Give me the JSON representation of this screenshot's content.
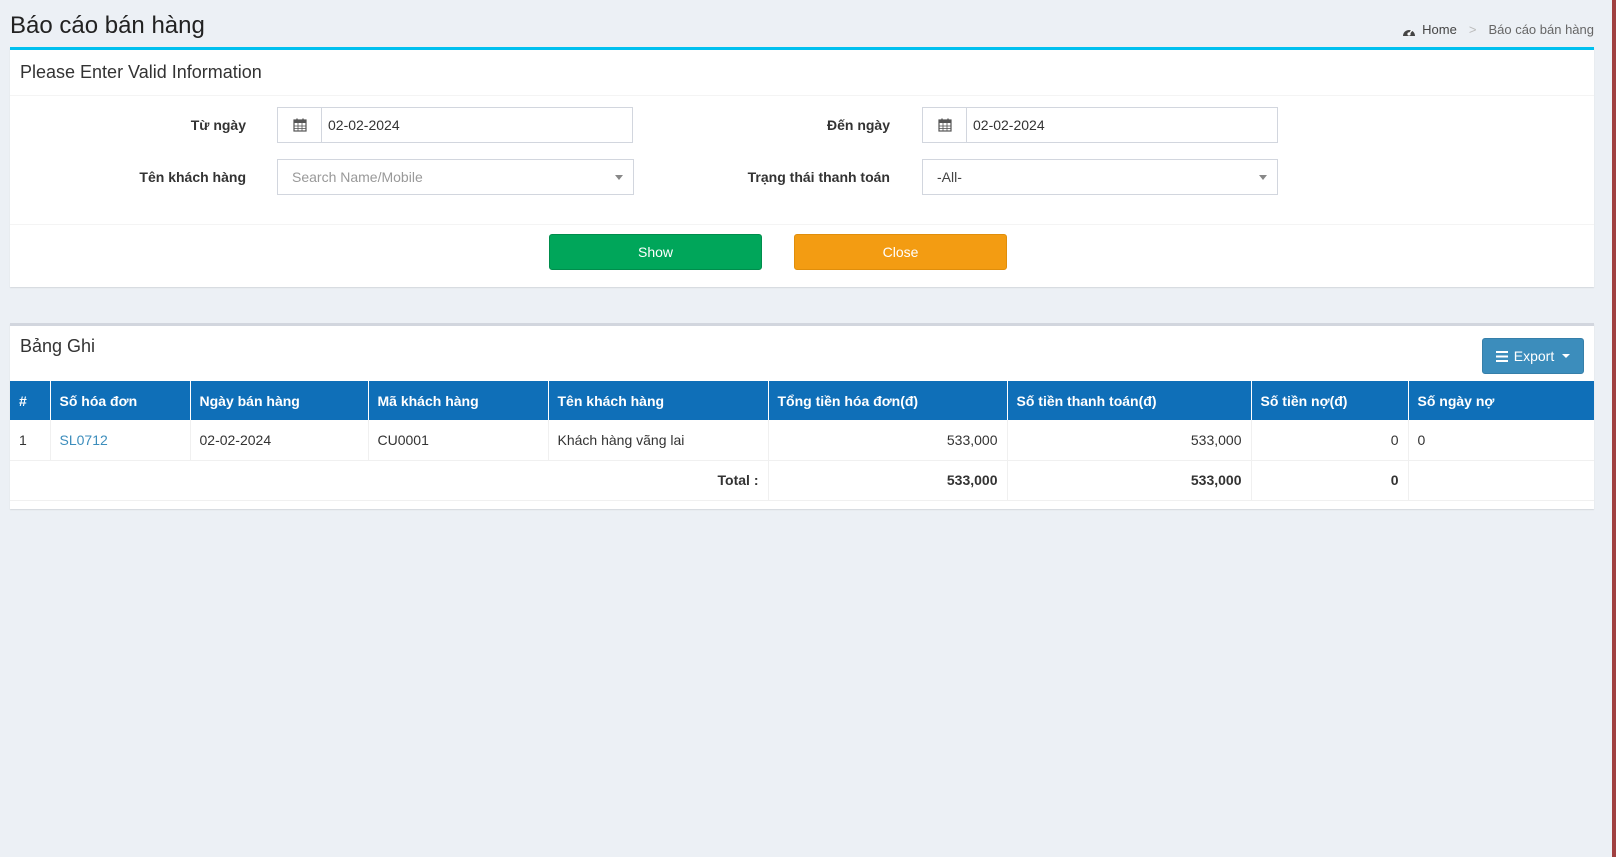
{
  "header": {
    "title": "Báo cáo bán hàng",
    "breadcrumb": {
      "home": "Home",
      "separator": ">",
      "current": "Báo cáo bán hàng"
    }
  },
  "filter": {
    "title": "Please Enter Valid Information",
    "from_label": "Từ ngày",
    "from_value": "02-02-2024",
    "to_label": "Đến ngày",
    "to_value": "02-02-2024",
    "customer_label": "Tên khách hàng",
    "customer_placeholder": "Search Name/Mobile",
    "status_label": "Trạng thái thanh toán",
    "status_value": "-All-",
    "show_label": "Show",
    "close_label": "Close"
  },
  "records": {
    "title": "Bảng Ghi",
    "export_label": "Export",
    "columns": [
      "#",
      "Số hóa đơn",
      "Ngày bán hàng",
      "Mã khách hàng",
      "Tên khách hàng",
      "Tổng tiền hóa đơn(đ)",
      "Số tiền thanh toán(đ)",
      "Số tiền nợ(đ)",
      "Số ngày nợ"
    ],
    "rows": [
      {
        "index": "1",
        "invoice": "SL0712",
        "date": "02-02-2024",
        "customer_code": "CU0001",
        "customer_name": "Khách hàng vãng lai",
        "total": "533,000",
        "paid": "533,000",
        "debt": "0",
        "debt_days": "0"
      }
    ],
    "totals": {
      "label": "Total :",
      "total": "533,000",
      "paid": "533,000",
      "debt": "0"
    }
  },
  "colors": {
    "accent": "#00c0ef",
    "table_header": "#0f6fb8",
    "show_button": "#00a65a",
    "close_button": "#f39c12",
    "export_button": "#3c8dbc"
  }
}
